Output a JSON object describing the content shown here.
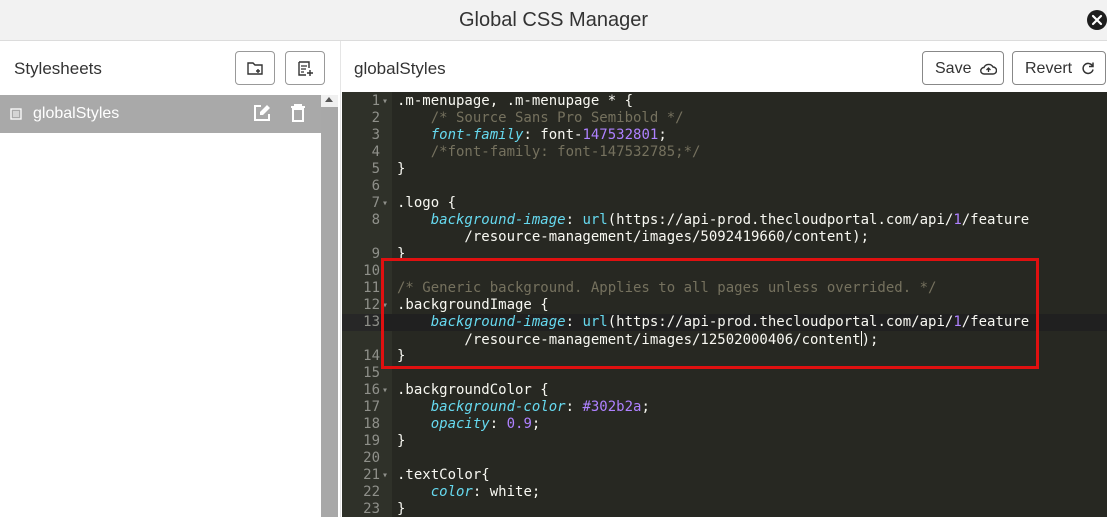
{
  "window": {
    "title": "Global CSS Manager"
  },
  "sidebar": {
    "title": "Stylesheets",
    "new_folder_icon": "folder-plus-icon",
    "new_sheet_icon": "file-plus-icon",
    "items": [
      {
        "label": "globalStyles",
        "selected": true
      }
    ]
  },
  "editor": {
    "title": "globalStyles",
    "save_label": "Save",
    "revert_label": "Revert",
    "lines": [
      {
        "n": "1",
        "t": ".m-menupage, .m-menupage * {"
      },
      {
        "n": "2",
        "t": "    /* Source Sans Pro Semibold */"
      },
      {
        "n": "3",
        "t": "    font-family: font-147532801;"
      },
      {
        "n": "4",
        "t": "    /*font-family: font-147532785;*/"
      },
      {
        "n": "5",
        "t": "}"
      },
      {
        "n": "6",
        "t": ""
      },
      {
        "n": "7",
        "t": ".logo {"
      },
      {
        "n": "8",
        "t": "    background-image: url(https://api-prod.thecloudportal.com/api/1/feature"
      },
      {
        "n": "",
        "t": "        /resource-management/images/5092419660/content);"
      },
      {
        "n": "9",
        "t": "}"
      },
      {
        "n": "10",
        "t": ""
      },
      {
        "n": "11",
        "t": "/* Generic background. Applies to all pages unless overrided. */"
      },
      {
        "n": "12",
        "t": ".backgroundImage {"
      },
      {
        "n": "13",
        "t": "    background-image: url(https://api-prod.thecloudportal.com/api/1/feature"
      },
      {
        "n": "",
        "t": "        /resource-management/images/12502000406/content);"
      },
      {
        "n": "14",
        "t": "}"
      },
      {
        "n": "15",
        "t": ""
      },
      {
        "n": "16",
        "t": ".backgroundColor {"
      },
      {
        "n": "17",
        "t": "    background-color: #302b2a;"
      },
      {
        "n": "18",
        "t": "    opacity: 0.9;"
      },
      {
        "n": "19",
        "t": "}"
      },
      {
        "n": "20",
        "t": ""
      },
      {
        "n": "21",
        "t": ".textColor{"
      },
      {
        "n": "22",
        "t": "    color: white;"
      },
      {
        "n": "23",
        "t": "}"
      }
    ]
  },
  "colors": {
    "editor_bg": "#272822",
    "highlight": "#e01010",
    "selected_item": "#a9a9a9"
  }
}
